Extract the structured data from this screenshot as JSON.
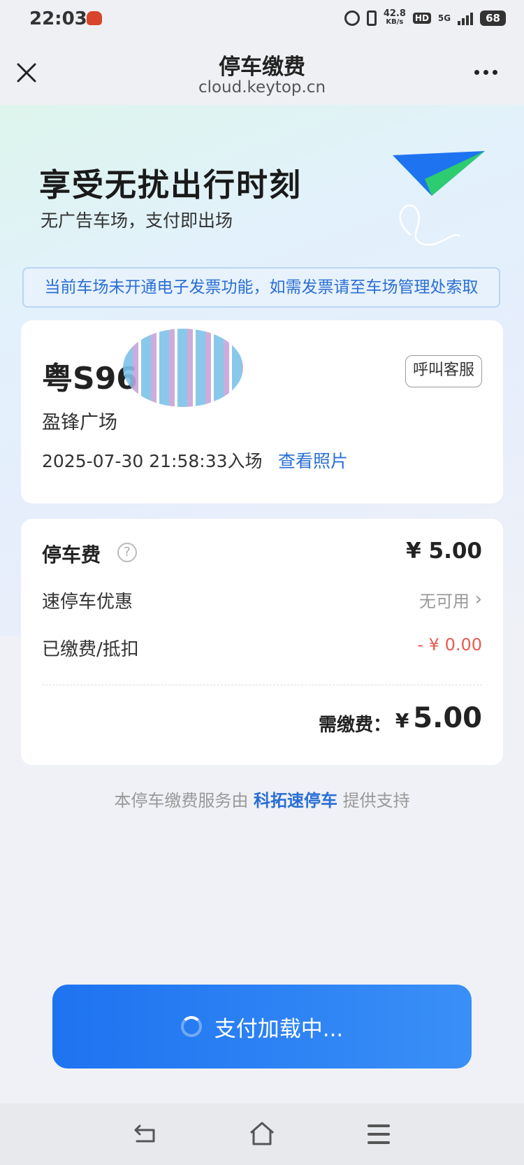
{
  "status_bar": {
    "time": "22:03",
    "net_speed_value": "42.8",
    "net_speed_unit": "KB/s",
    "hd_label": "HD",
    "network_label": "5G",
    "battery": "68"
  },
  "header": {
    "title": "停车缴费",
    "url": "cloud.keytop.cn"
  },
  "hero": {
    "title": "享受无扰出行时刻",
    "subtitle": "无广告车场，支付即出场"
  },
  "notice": "当前车场未开通电子发票功能，如需发票请至车场管理处索取",
  "vehicle": {
    "plate": "粤S96",
    "service_button": "呼叫客服",
    "lot_name": "盈锋广场",
    "entry_time": "2025-07-30 21:58:33入场",
    "photo_link": "查看照片"
  },
  "fees": {
    "parking_fee_label": "停车费",
    "parking_fee_amount": "¥ 5.00",
    "discount_label": "速停车优惠",
    "discount_value": "无可用",
    "paid_label": "已缴费/抵扣",
    "paid_value": "- ¥ 0.00",
    "due_label": "需缴费：",
    "due_currency": "¥",
    "due_amount": "5.00"
  },
  "footer": {
    "prefix": "本停车缴费服务由 ",
    "provider": "科拓速停车",
    "suffix": " 提供支持"
  },
  "pay_button": {
    "label": "支付加载中..."
  },
  "colors": {
    "accent": "#2a6fd4",
    "pay_button": "#1e73f0",
    "negative": "#e85b51"
  }
}
